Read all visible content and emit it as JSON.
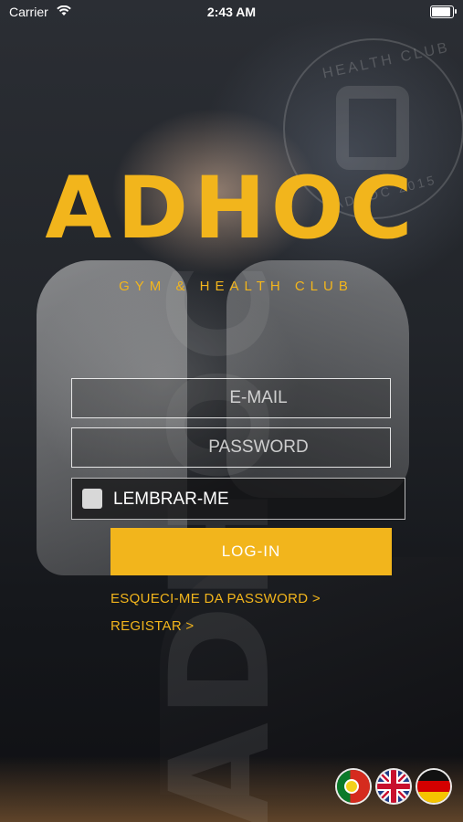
{
  "status_bar": {
    "carrier": "Carrier",
    "time": "2:43 AM",
    "battery_level": 1.0
  },
  "brand": {
    "logo": "ADHOC",
    "tagline": "GYM & HEALTH CLUB",
    "watermark": "ADHOC",
    "seal_top": "HEALTH CLUB",
    "seal_bottom": "ADHOC 2015"
  },
  "form": {
    "email_placeholder": "E-MAIL",
    "password_placeholder": "PASSWORD",
    "remember_label": "LEMBRAR-ME",
    "remember_checked": false,
    "login_label": "LOG-IN",
    "forgot_link": "ESQUECI-ME DA PASSWORD >",
    "register_link": "REGISTAR >"
  },
  "languages": [
    {
      "code": "pt",
      "icon": "portugal-flag-icon"
    },
    {
      "code": "en",
      "icon": "uk-flag-icon"
    },
    {
      "code": "de",
      "icon": "germany-flag-icon"
    }
  ],
  "colors": {
    "accent": "#f2b51c",
    "text": "#ffffff"
  }
}
